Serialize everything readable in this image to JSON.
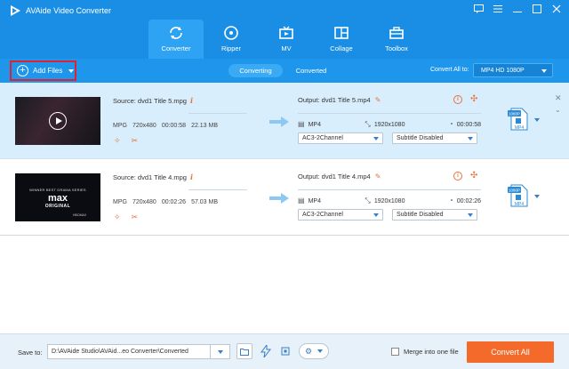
{
  "app": {
    "title": "AVAide Video Converter"
  },
  "window_controls": [
    "chat-icon",
    "menu-icon",
    "minimize-icon",
    "maximize-icon",
    "close-icon"
  ],
  "tabs": [
    {
      "label": "Converter",
      "icon": "converter-icon",
      "active": true
    },
    {
      "label": "Ripper",
      "icon": "ripper-icon",
      "active": false
    },
    {
      "label": "MV",
      "icon": "mv-icon",
      "active": false
    },
    {
      "label": "Collage",
      "icon": "collage-icon",
      "active": false
    },
    {
      "label": "Toolbox",
      "icon": "toolbox-icon",
      "active": false
    }
  ],
  "toolbar": {
    "add_files": "Add Files",
    "segments": {
      "converting": "Converting",
      "converted": "Converted"
    },
    "convert_all_to_label": "Convert All to:",
    "convert_all_format": "MP4 HD 1080P"
  },
  "files": [
    {
      "source": "Source: dvd1 Title 5.mpg",
      "format": "MPG",
      "resolution": "720x480",
      "duration": "00:00:58",
      "size": "22.13 MB",
      "output": "Output: dvd1 Title 5.mp4",
      "out_format": "MP4",
      "out_resolution": "1920x1080",
      "out_duration": "00:00:58",
      "audio": "AC3-2Channel",
      "subtitle": "Subtitle Disabled"
    },
    {
      "source": "Source: dvd1 Title 4.mpg",
      "format": "MPG",
      "resolution": "720x480",
      "duration": "00:02:26",
      "size": "57.03 MB",
      "output": "Output: dvd1 Title 4.mp4",
      "out_format": "MP4",
      "out_resolution": "1920x1080",
      "out_duration": "00:02:26",
      "audio": "AC3-2Channel",
      "subtitle": "Subtitle Disabled",
      "thumb_text": {
        "small": "WINNER BEST DRAMA SERIES",
        "brand": "max",
        "series": "ORIGINAL",
        "corner": "HBOMAX"
      }
    }
  ],
  "format_badge": {
    "res": "1080P",
    "fmt": "MP4"
  },
  "footer": {
    "save_to_label": "Save to:",
    "save_path": "D:\\AVAide Studio\\AVAid...eo Converter\\Converted",
    "merge_label": "Merge into one file",
    "convert_all_button": "Convert All"
  },
  "colors": {
    "header": "#1a8ee5",
    "accent": "#f36a2b",
    "selected_row": "#d9eefc"
  }
}
